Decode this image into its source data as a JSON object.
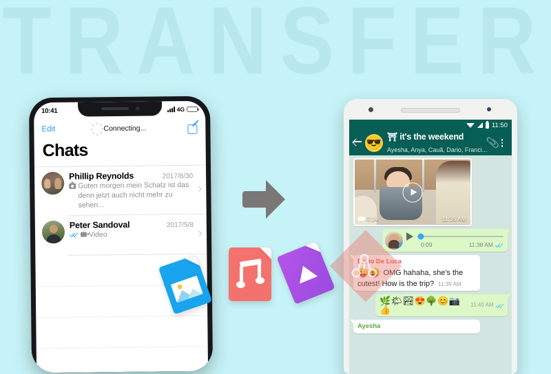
{
  "background": {
    "color": "#c6f3f7",
    "watermark_text": "TRANSFER",
    "watermark_color": "#b9e8ec"
  },
  "arrow": {
    "name": "transfer-arrow",
    "direction": "right",
    "color": "#7a7876"
  },
  "file_icons": [
    {
      "type": "photo",
      "label": "photo-file-icon",
      "color": "#1aa3ef"
    },
    {
      "type": "music",
      "label": "music-file-icon",
      "color": "#f4726d"
    },
    {
      "type": "video",
      "label": "video-file-icon",
      "color": "#9b4ae0"
    }
  ],
  "iphone": {
    "status_bar": {
      "time": "10:41",
      "network": "4G",
      "battery_level": "62"
    },
    "nav": {
      "edit_label": "Edit",
      "status_label": "Connecting...",
      "compose_icon": "compose-icon"
    },
    "title": "Chats",
    "chats": [
      {
        "name": "Phillip Reynolds",
        "date": "2017/8/30",
        "preview": "Guten morgen mein Schatz ist das denn jetzt auch nicht mehr zu sehen...",
        "preview_icon": "camera-icon",
        "read_receipt": false
      },
      {
        "name": "Peter Sandoval",
        "date": "2017/5/8",
        "preview": "Video",
        "preview_icon": "video-icon",
        "read_receipt": true
      }
    ]
  },
  "android": {
    "status_bar": {
      "time": "11:50",
      "wifi_icon": "wifi-icon",
      "signal_icon": "signal-icon",
      "battery_icon": "battery-icon"
    },
    "header": {
      "back_icon": "back-arrow-icon",
      "avatar_emoji": "😎",
      "group_emoji": "⛩",
      "group_name": "it's the weekend",
      "members": "Ayesha, Anya, Cauã, Dario, Franci...",
      "attach_icon": "paperclip-icon",
      "menu_icon": "overflow-menu-icon"
    },
    "messages": [
      {
        "kind": "video",
        "duration": "0:14",
        "time": "11:35 AM",
        "outgoing": false
      },
      {
        "kind": "voice",
        "duration": "0:09",
        "time": "11:38 AM",
        "outgoing": true,
        "receipt": "read"
      },
      {
        "kind": "text",
        "sender": "Dario De Luca",
        "sender_color": "#e8554e",
        "emoji": "😜😝",
        "text": "OMG hahaha, she's the cutest! How is the trip?",
        "time": "11:39 AM",
        "outgoing": false
      },
      {
        "kind": "emoji",
        "emoji": "🌿🌤🏞😍🌳😊📷👍",
        "time": "11:40 AM",
        "outgoing": true,
        "receipt": "read"
      },
      {
        "kind": "text",
        "sender": "Ayesha",
        "sender_color": "#5fa83c",
        "text": "",
        "time": "",
        "outgoing": false
      }
    ]
  }
}
